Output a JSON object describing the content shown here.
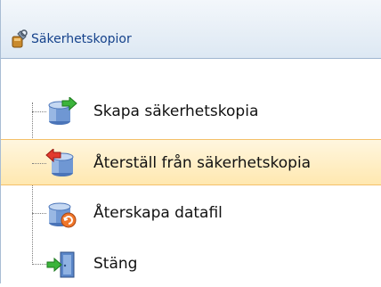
{
  "header": {
    "title": "Säkerhetskopior",
    "icon": "wrench-backup-icon"
  },
  "items": [
    {
      "label": "Skapa säkerhetskopia",
      "icon": "database-arrow-in-icon",
      "selected": false
    },
    {
      "label": "Återställ från säkerhetskopia",
      "icon": "database-arrow-out-icon",
      "selected": true
    },
    {
      "label": "Återskapa datafil",
      "icon": "database-repair-icon",
      "selected": false
    },
    {
      "label": "Stäng",
      "icon": "exit-door-icon",
      "selected": false
    }
  ],
  "colors": {
    "header_text": "#15428b",
    "selection_border": "#f4c06a",
    "selection_fill": "#ffe8b0"
  }
}
